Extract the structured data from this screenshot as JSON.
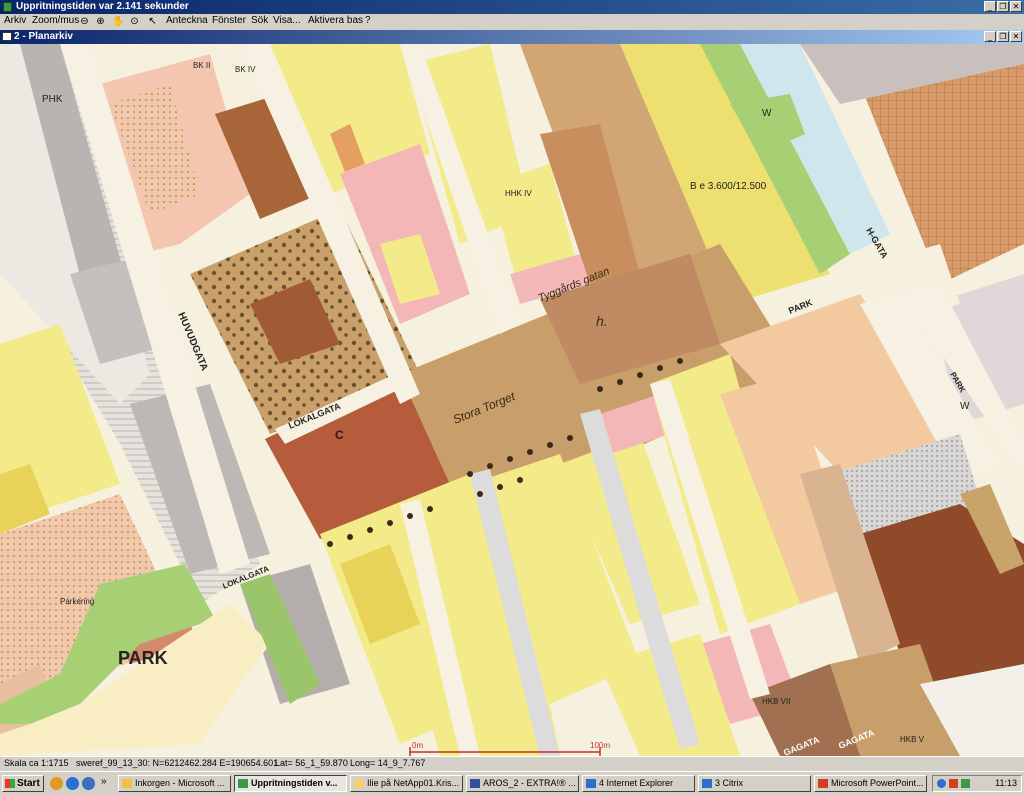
{
  "window": {
    "title": "Uppritningstiden var 2.141 sekunder",
    "controls": [
      "_",
      "❐",
      "✕"
    ]
  },
  "menu": {
    "items": [
      "Arkiv",
      "Zoom/mus",
      "Anteckna",
      "Fönster",
      "Sök",
      "Visa...",
      "Aktivera bas",
      "?"
    ],
    "tools": [
      "zoom-out-icon",
      "zoom-in-icon",
      "pan-hand-icon",
      "zoom-extent-icon",
      "pointer-arrow-icon"
    ]
  },
  "subwindow": {
    "title": "2 - Planarkiv",
    "controls": [
      "_",
      "❐",
      "✕"
    ]
  },
  "map": {
    "labels": {
      "huvudgata": "HUVUDGATA",
      "lokalgata": "LOKALGATA",
      "lokalgata2": "LOKALGATA",
      "stora_torget": "Stora Torget",
      "tyggardsgatan": "Tyggårds gatan",
      "park1": "PARK",
      "park2": "PARK",
      "park3": "PARK",
      "hgata": "H-GATA",
      "gagata": "GAGATA",
      "gagata2": "GAGATA",
      "be": "B e 3.600/12.500",
      "phk": "PHK",
      "bkii": "BK II",
      "bkiv": "BK IV",
      "w1": "W",
      "w2": "W",
      "hhk": "HHK IV",
      "hkb": "HKB VII",
      "hkbv": "HKB V",
      "parkering": "Parkering",
      "scale0": "0m",
      "scale100": "100m",
      "h": "h.",
      "c": "C"
    }
  },
  "status": {
    "scale": "Skala ca 1:1715",
    "coords": "sweref_99_13_30: N=6212462.284  E=190654.601",
    "lat": "Lat= 56_1_59.870",
    "long": "Long= 14_9_7.767"
  },
  "taskbar": {
    "start": "Start",
    "tasks": [
      {
        "label": "Inkorgen - Microsoft ...",
        "active": false,
        "color": "#f0c040"
      },
      {
        "label": "Uppritningstiden v...",
        "active": true,
        "color": "#3c9a46"
      },
      {
        "label": "Ilie på NetApp01.Kris...",
        "active": false,
        "color": "#f0d070"
      },
      {
        "label": "AROS_2 - EXTRA!® ...",
        "active": false,
        "color": "#3050a0"
      },
      {
        "label": "4 Internet Explorer",
        "active": false,
        "color": "#2a6fd0"
      },
      {
        "label": "3 Citrix",
        "active": false,
        "color": "#2a6fd0"
      },
      {
        "label": "Microsoft PowerPoint...",
        "active": false,
        "color": "#d04020"
      }
    ],
    "clock": "11:13",
    "more": "»"
  },
  "colors": {
    "yellow": "#f3ea8a",
    "pink": "#f4b7b7",
    "brown": "#b57b52",
    "tan": "#c89e6a",
    "green": "#a7cf73",
    "gray": "#bdb8b5",
    "road": "#f7f1e3"
  }
}
